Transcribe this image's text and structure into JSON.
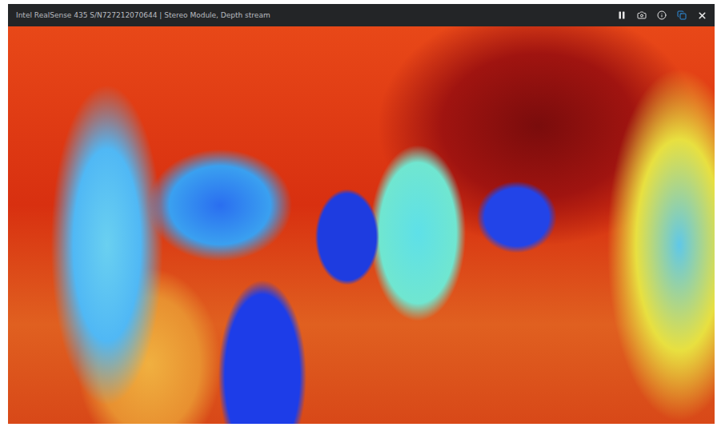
{
  "window": {
    "title": "Intel RealSense 435 S/N727212070644 | Stereo Module, Depth stream"
  }
}
